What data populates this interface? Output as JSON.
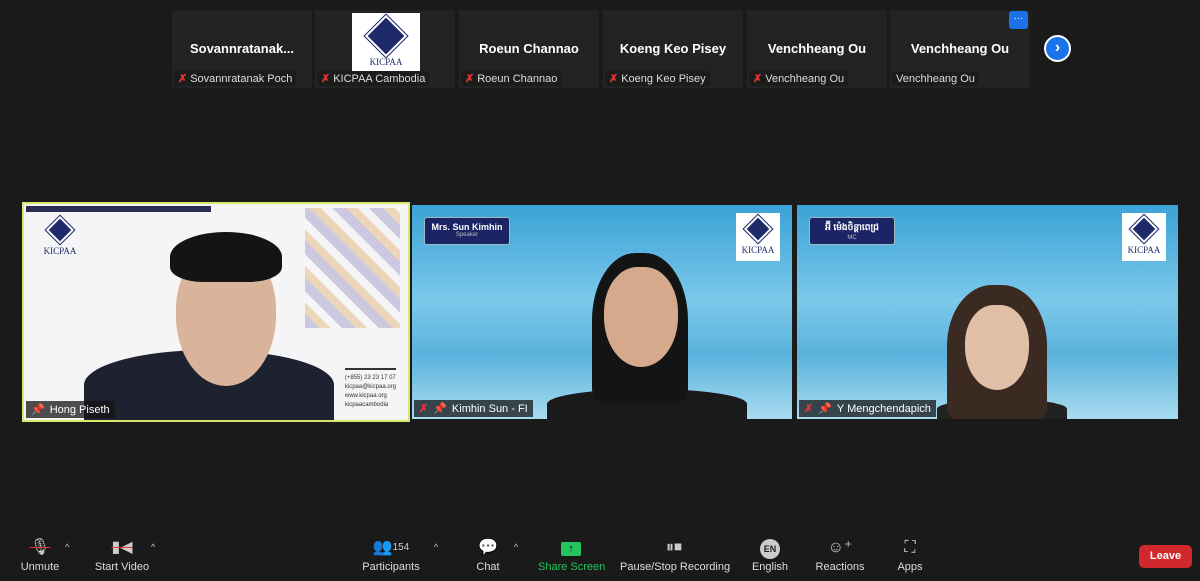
{
  "gallery_strip": [
    {
      "display": "Sovannratanak...",
      "label": "Sovannratanak Poch",
      "muted": true
    },
    {
      "display": "",
      "label": "KICPAA Cambodia",
      "muted": true,
      "logo": "KICPAA"
    },
    {
      "display": "Roeun Channao",
      "label": "Roeun Channao",
      "muted": true
    },
    {
      "display": "Koeng Keo Pisey",
      "label": "Koeng Keo Pisey",
      "muted": true
    },
    {
      "display": "Venchheang Ou",
      "label": "Venchheang Ou",
      "muted": true
    },
    {
      "display": "Venchheang Ou",
      "label": "Venchheang Ou",
      "muted": false
    }
  ],
  "more_label": "···",
  "next_icon": "›",
  "videos": [
    {
      "name": "Hong Piseth",
      "logo": "KICPAA",
      "contact": [
        "(+855) 23 23 17 07",
        "kicpaa@kicpaa.org",
        "www.kicpaa.org",
        "kicpaacambodia"
      ],
      "active_speaker": true
    },
    {
      "name": "Kimhin Sun - FI",
      "banner_title": "Mrs. Sun Kimhin",
      "banner_sub": "Speaker",
      "logo": "KICPAA"
    },
    {
      "name": "Y Mengchendapich",
      "banner_title": "អ៊ី ម៉េងចិន្តាពេជ្រ",
      "banner_sub": "MC",
      "logo": "KICPAA"
    }
  ],
  "toolbar": {
    "unmute": "Unmute",
    "start_video": "Start Video",
    "participants": "Participants",
    "participant_count": "154",
    "chat": "Chat",
    "share_screen": "Share Screen",
    "recording": "Pause/Stop Recording",
    "language": "English",
    "language_code": "EN",
    "reactions": "Reactions",
    "apps": "Apps",
    "leave": "Leave",
    "share_color": "#22c55e",
    "leave_color": "#d0282c"
  }
}
